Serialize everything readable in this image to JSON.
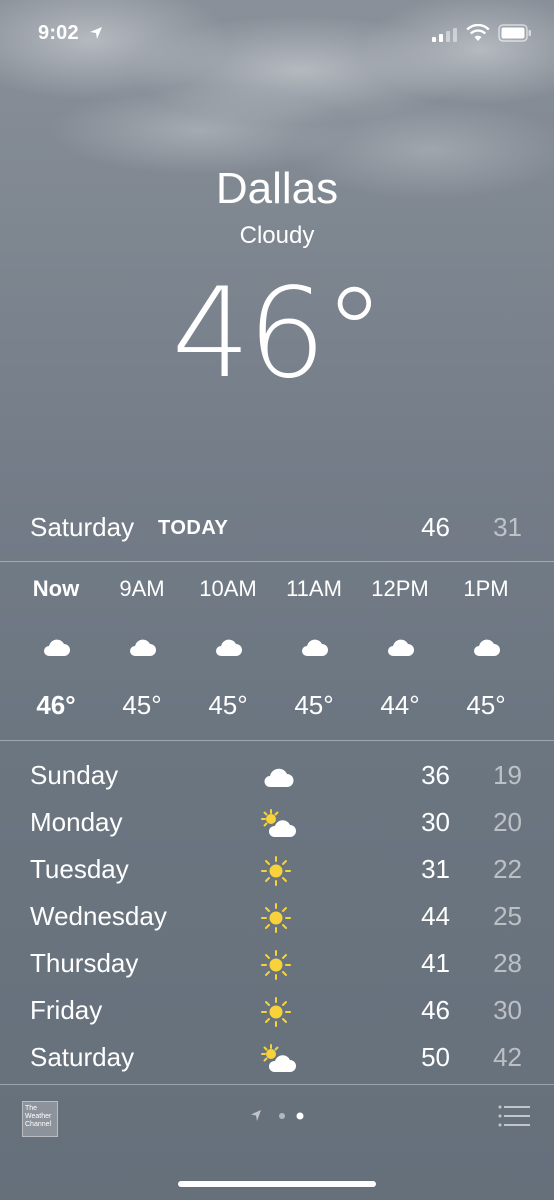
{
  "status_bar": {
    "time": "9:02"
  },
  "weather": {
    "city": "Dallas",
    "condition": "Cloudy",
    "temperature": "46°"
  },
  "today": {
    "day": "Saturday",
    "label": "TODAY",
    "high": "46",
    "low": "31"
  },
  "hourly": [
    {
      "time": "Now",
      "icon": "cloud-icon",
      "temp": "46°"
    },
    {
      "time": "9AM",
      "icon": "cloud-icon",
      "temp": "45°"
    },
    {
      "time": "10AM",
      "icon": "cloud-icon",
      "temp": "45°"
    },
    {
      "time": "11AM",
      "icon": "cloud-icon",
      "temp": "45°"
    },
    {
      "time": "12PM",
      "icon": "cloud-icon",
      "temp": "44°"
    },
    {
      "time": "1PM",
      "icon": "cloud-icon",
      "temp": "45°"
    }
  ],
  "daily": [
    {
      "day": "Sunday",
      "icon": "cloud-icon",
      "high": "36",
      "low": "19"
    },
    {
      "day": "Monday",
      "icon": "partly-sunny-icon",
      "high": "30",
      "low": "20"
    },
    {
      "day": "Tuesday",
      "icon": "sun-icon",
      "high": "31",
      "low": "22"
    },
    {
      "day": "Wednesday",
      "icon": "sun-icon",
      "high": "44",
      "low": "25"
    },
    {
      "day": "Thursday",
      "icon": "sun-icon",
      "high": "41",
      "low": "28"
    },
    {
      "day": "Friday",
      "icon": "sun-icon",
      "high": "46",
      "low": "30"
    },
    {
      "day": "Saturday",
      "icon": "partly-sunny-icon",
      "high": "50",
      "low": "42"
    }
  ],
  "footer": {
    "logo_text": "The Weather Channel"
  },
  "colors": {
    "sun": "#f7d23a",
    "text": "#ffffff"
  }
}
